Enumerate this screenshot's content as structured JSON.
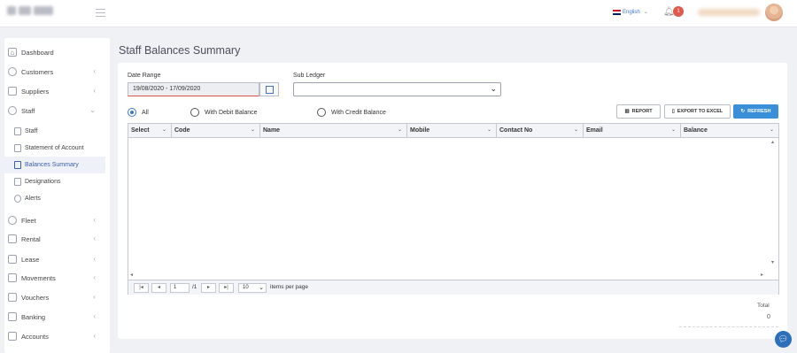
{
  "header": {
    "language": "English",
    "notification_count": "1"
  },
  "sidebar": {
    "items": [
      {
        "label": "Dashboard"
      },
      {
        "label": "Customers"
      },
      {
        "label": "Suppliers"
      },
      {
        "label": "Staff"
      },
      {
        "label": "Fleet"
      },
      {
        "label": "Rental"
      },
      {
        "label": "Lease"
      },
      {
        "label": "Movements"
      },
      {
        "label": "Vouchers"
      },
      {
        "label": "Banking"
      },
      {
        "label": "Accounts"
      }
    ],
    "staff_sub": [
      {
        "label": "Staff"
      },
      {
        "label": "Statement of Account"
      },
      {
        "label": "Balances Summary",
        "active": true
      },
      {
        "label": "Designations"
      },
      {
        "label": "Alerts"
      }
    ]
  },
  "page": {
    "title": "Staff Balances Summary"
  },
  "filters": {
    "date_range_label": "Date Range",
    "date_range_value": "19/08/2020 - 17/09/2020",
    "sub_ledger_label": "Sub Ledger",
    "sub_ledger_value": "",
    "radios": [
      {
        "label": "All",
        "checked": true
      },
      {
        "label": "With Debit Balance",
        "checked": false
      },
      {
        "label": "With Credit Balance",
        "checked": false
      }
    ]
  },
  "actions": {
    "report": "REPORT",
    "export": "EXPORT TO EXCEL",
    "refresh": "REFRESH"
  },
  "grid": {
    "columns": [
      "Select",
      "Code",
      "Name",
      "Mobile",
      "Contact No",
      "Email",
      "Balance"
    ],
    "rows": [],
    "pager": {
      "page": "1",
      "of": "/1",
      "page_size": "10",
      "per_page_label": "items per page"
    }
  },
  "summary": {
    "total_label": "Total",
    "total_value": "0"
  },
  "colors": {
    "accent": "#3a8fd8",
    "badge": "#e2574c",
    "active_nav": "#3a5fa7"
  }
}
